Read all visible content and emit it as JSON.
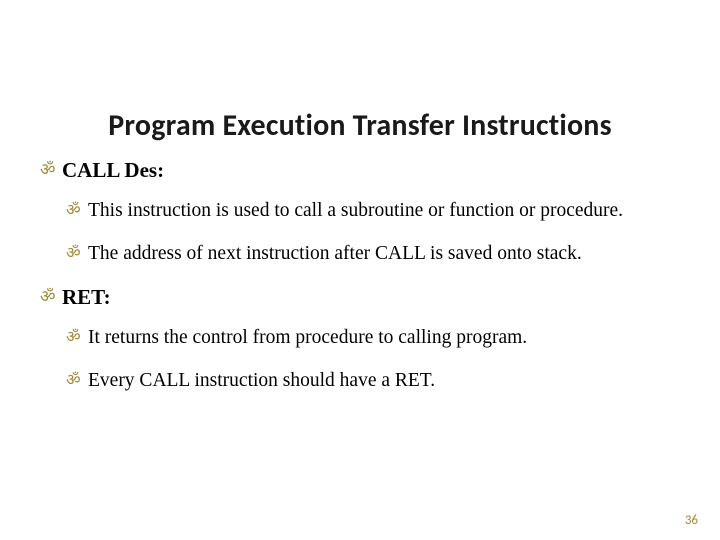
{
  "title": "Program Execution Transfer Instructions",
  "bullet_glyph": "ॐ",
  "sections": [
    {
      "heading": "CALL Des:",
      "items": [
        "This instruction is used to call a subroutine or function or procedure.",
        "The address of next instruction after CALL is saved onto stack."
      ]
    },
    {
      "heading": "RET:",
      "items": [
        "It returns the control from procedure to calling program.",
        "Every CALL instruction should have a RET."
      ]
    }
  ],
  "page_number": "36"
}
